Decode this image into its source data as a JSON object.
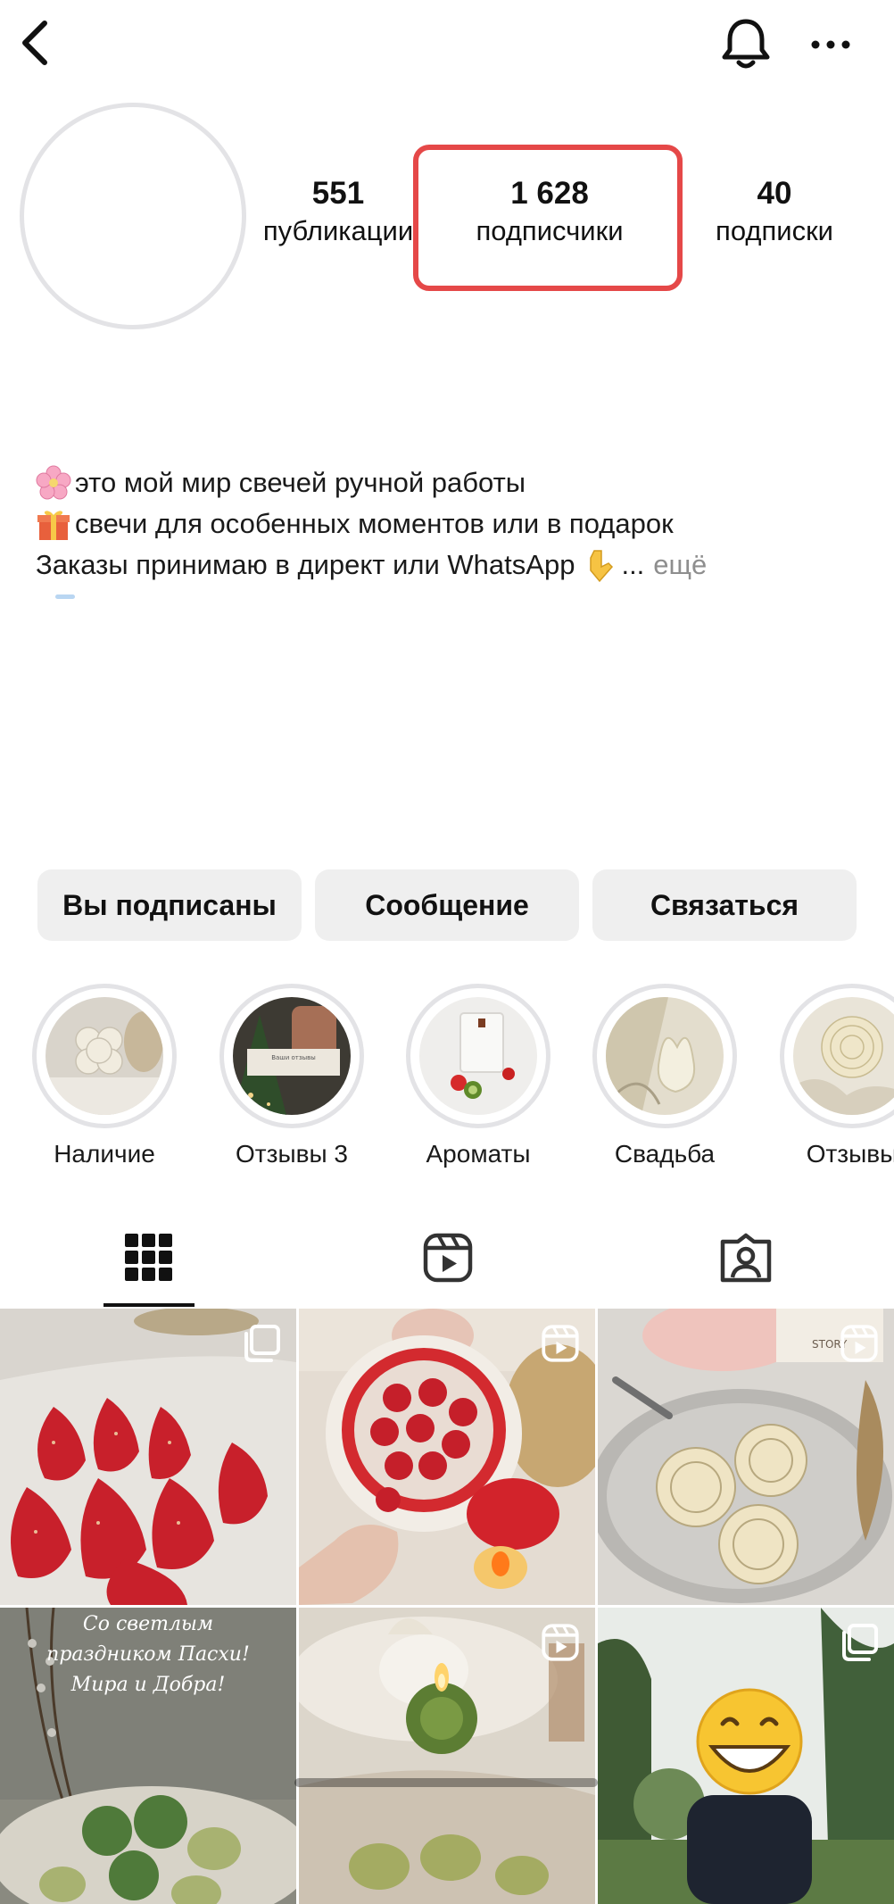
{
  "profile": {
    "stats": [
      {
        "value": "551",
        "label": "публикации"
      },
      {
        "value": "1 628",
        "label": "подписчики"
      },
      {
        "value": "40",
        "label": "подписки"
      }
    ],
    "bio": {
      "line1": "это мой мир свечей ручной работы",
      "line2": "свечи для особенных моментов или в подарок",
      "line3": "Заказы принимаю в директ или WhatsApp",
      "line3_suffix": "...",
      "more": "ещё"
    }
  },
  "buttons": {
    "following": "Вы подписаны",
    "message": "Сообщение",
    "contact": "Связаться"
  },
  "highlights": [
    {
      "label": "Наличие"
    },
    {
      "label": "Отзывы 3"
    },
    {
      "label": "Ароматы"
    },
    {
      "label": "Свадьба"
    },
    {
      "label": "Отзывы"
    }
  ],
  "highlight_cover_text": "Ваши отзывы",
  "tabs": [
    {
      "icon": "grid-icon",
      "active": true
    },
    {
      "icon": "reels-icon",
      "active": false
    },
    {
      "icon": "tagged-icon",
      "active": false
    }
  ],
  "posts": [
    {
      "type": "carousel",
      "badge": "carousel-icon"
    },
    {
      "type": "reel",
      "badge": "reels-icon"
    },
    {
      "type": "reel",
      "badge": "reels-icon",
      "overlay_text": "STORY"
    },
    {
      "type": "photo",
      "caption_lines": [
        "Со светлым",
        "праздником Пасхи!",
        "Мира и Добра!"
      ]
    },
    {
      "type": "reel",
      "badge": "reels-icon"
    },
    {
      "type": "carousel",
      "badge": "carousel-icon"
    }
  ],
  "colors": {
    "highlight_box": "#e54848",
    "button_bg": "#efefef",
    "ring": "#e3e3e6",
    "muted": "#8e8e8e"
  }
}
